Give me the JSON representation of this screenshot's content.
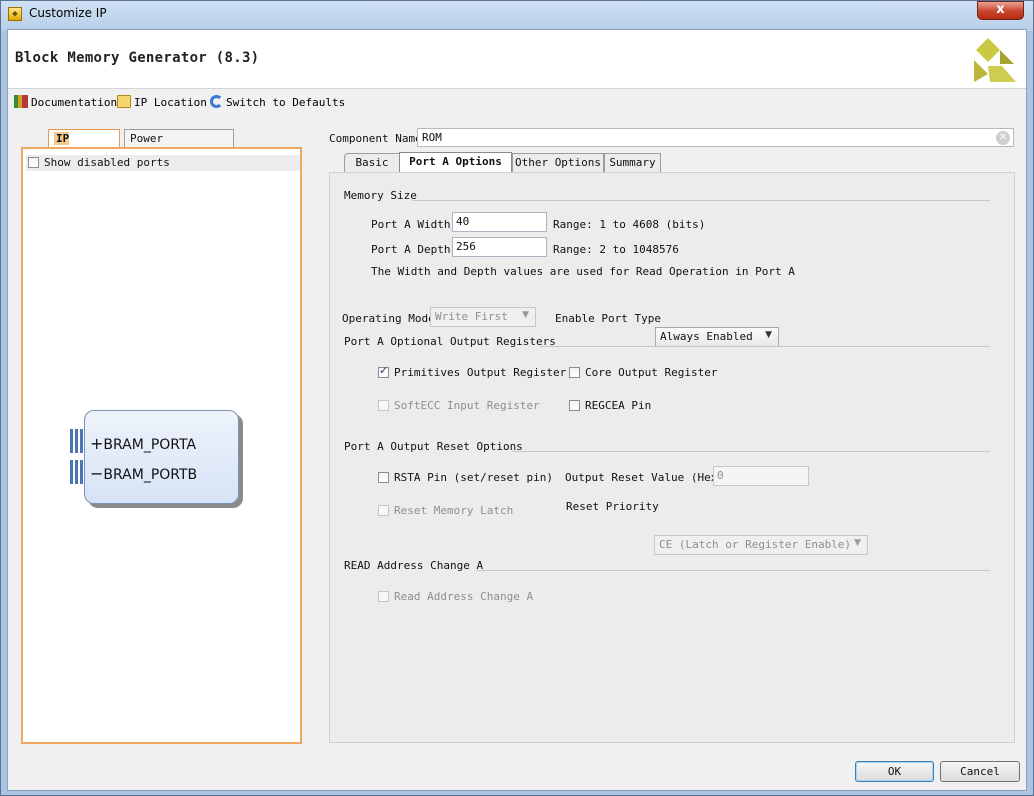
{
  "window": {
    "title": "Customize IP",
    "close_label": "x"
  },
  "header": {
    "title": "Block Memory Generator (8.3)"
  },
  "toolbar": {
    "documentation": "Documentation",
    "ip_location": "IP Location",
    "switch_defaults": "Switch to Defaults"
  },
  "left": {
    "tabs": [
      "IP Symbol",
      "Power Estimation"
    ],
    "show_disabled": "Show disabled ports",
    "ports": [
      "BRAM_PORTA",
      "BRAM_PORTB"
    ]
  },
  "component": {
    "label": "Component Name",
    "value": "ROM"
  },
  "tabs": [
    "Basic",
    "Port A Options",
    "Other Options",
    "Summary"
  ],
  "memory_size": {
    "section": "Memory Size",
    "width_label": "Port A Width",
    "width_value": "40",
    "width_range": "Range: 1 to 4608 (bits)",
    "depth_label": "Port A Depth",
    "depth_value": "256",
    "depth_range": "Range: 2 to 1048576",
    "note": "The Width and Depth values are used for Read Operation in Port A"
  },
  "operating": {
    "mode_label": "Operating Mode",
    "mode_value": "Write First",
    "enable_label": "Enable Port Type",
    "enable_value": "Always Enabled"
  },
  "output_registers": {
    "section": "Port A Optional Output Registers",
    "primitives": "Primitives Output Register",
    "core": "Core Output Register",
    "softecc": "SoftECC Input Register",
    "regcea": "REGCEA Pin"
  },
  "reset_options": {
    "section": "Port A Output Reset Options",
    "rsta": "RSTA Pin (set/reset pin)",
    "reset_value_label": "Output Reset Value (Hex)",
    "reset_value": "0",
    "latch": "Reset Memory Latch",
    "priority_label": "Reset Priority",
    "priority_value": "CE (Latch or Register Enable)"
  },
  "read_address": {
    "section": "READ Address Change A",
    "checkbox": "Read Address Change A"
  },
  "buttons": {
    "ok": "OK",
    "cancel": "Cancel"
  }
}
